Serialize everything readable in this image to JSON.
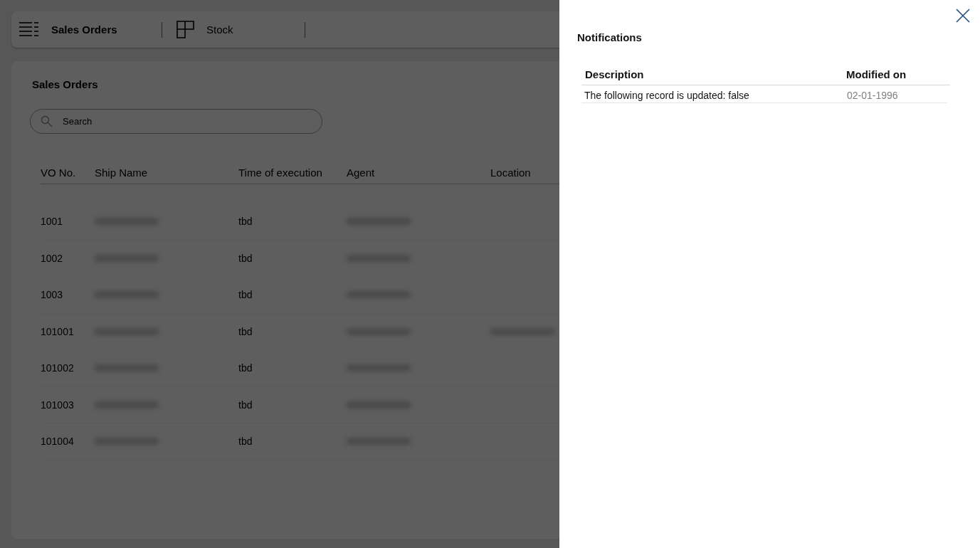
{
  "top_nav": {
    "items": [
      {
        "label": "Sales Orders",
        "selected": true
      },
      {
        "label": "Stock",
        "selected": false
      }
    ]
  },
  "sales_orders": {
    "title": "Sales Orders",
    "search": {
      "placeholder": "Search"
    },
    "table": {
      "columns": [
        "VO No.",
        "Ship Name",
        "Time of execution",
        "Agent",
        "Location"
      ],
      "rows": [
        {
          "vo_no": "1001",
          "ship_name": {
            "kind": "redacted"
          },
          "time_of_execution": "tbd",
          "agent": {
            "kind": "redacted"
          }
        },
        {
          "vo_no": "1002",
          "ship_name": {
            "kind": "redacted"
          },
          "time_of_execution": "tbd",
          "agent": {
            "kind": "redacted"
          }
        },
        {
          "vo_no": "1003",
          "ship_name": {
            "kind": "redacted"
          },
          "time_of_execution": "tbd",
          "agent": {
            "kind": "redacted"
          }
        },
        {
          "vo_no": "101001",
          "ship_name": {
            "kind": "redacted"
          },
          "time_of_execution": "tbd",
          "agent": {
            "kind": "redacted"
          },
          "location": {
            "kind": "redacted"
          }
        },
        {
          "vo_no": "101002",
          "ship_name": {
            "kind": "redacted"
          },
          "time_of_execution": "tbd",
          "agent": {
            "kind": "redacted"
          }
        },
        {
          "vo_no": "101003",
          "ship_name": {
            "kind": "redacted"
          },
          "time_of_execution": "tbd",
          "agent": {
            "kind": "redacted"
          }
        },
        {
          "vo_no": "101004",
          "ship_name": {
            "kind": "redacted"
          },
          "time_of_execution": "tbd",
          "agent": {
            "kind": "redacted"
          }
        }
      ]
    }
  },
  "notifications_panel": {
    "title": "Notifications",
    "table": {
      "columns": [
        "Description",
        "Modified on"
      ],
      "rows": [
        {
          "description": "The following record is updated: false",
          "modified_on": "02-01-1996"
        }
      ]
    }
  }
}
